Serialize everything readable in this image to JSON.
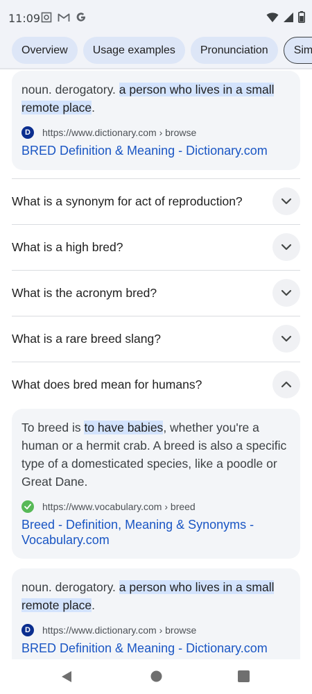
{
  "status_bar": {
    "time": "11:09",
    "left_icons": [
      "screenshot-icon",
      "gmail-icon",
      "google-icon"
    ],
    "right_icons": [
      "wifi-icon",
      "signal-icon",
      "battery-icon"
    ]
  },
  "chips": [
    {
      "label": "Overview"
    },
    {
      "label": "Usage examples"
    },
    {
      "label": "Pronunciation"
    },
    {
      "label": "Similar"
    }
  ],
  "top_card": {
    "text_before": "noun. derogatory. ",
    "text_highlight": "a person who lives in a small remote place",
    "text_after": ".",
    "source_url": "https://www.dictionary.com › browse",
    "source_title": "BRED Definition & Meaning - Dictionary.com",
    "favicon": "dictionary-favicon-icon"
  },
  "faqs": [
    {
      "question": "What is a synonym for act of reproduction?",
      "expanded": false
    },
    {
      "question": "What is a high bred?",
      "expanded": false
    },
    {
      "question": "What is the acronym bred?",
      "expanded": false
    },
    {
      "question": "What is a rare breed slang?",
      "expanded": false
    },
    {
      "question": "What does bred mean for humans?",
      "expanded": true
    }
  ],
  "answer_card": {
    "text_before": "To breed is ",
    "text_highlight": "to have babies",
    "text_after": ", whether you're a human or a hermit crab. A breed is also a specific type of a domesticated species, like a poodle or Great Dane.",
    "source_url": "https://www.vocabulary.com › breed",
    "source_title": "Breed - Definition, Meaning & Synonyms - Vocabulary.com",
    "favicon": "vocabulary-favicon-icon"
  },
  "bottom_card": {
    "text_before": "noun. derogatory. ",
    "text_highlight": "a person who lives in a small remote place",
    "text_after": ".",
    "source_url": "https://www.dictionary.com › browse",
    "source_title": "BRED Definition & Meaning - Dictionary.com",
    "favicon": "dictionary-favicon-icon"
  },
  "nav_bar": {
    "buttons": [
      "back-icon",
      "home-icon",
      "recents-icon"
    ]
  },
  "colors": {
    "link": "#1a56c4",
    "highlight": "#d3e3fd",
    "chip_bg": "#dde6f7",
    "card_bg": "#f3f5f8"
  }
}
